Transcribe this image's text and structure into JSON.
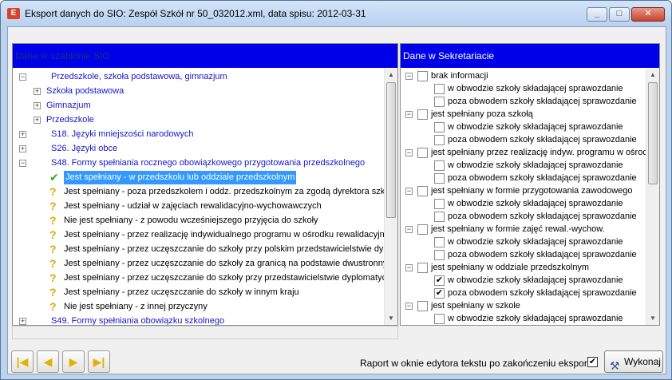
{
  "window": {
    "title": "Eksport danych do SIO: Zespół Szkół nr 50_032012.xml, data spisu: 2012-03-31",
    "app_icon_glyph": "E"
  },
  "left_panel": {
    "header": "Dane w szablonie SIO",
    "rows": [
      {
        "text": "Przedszkole, szkoła podstawowa, gimnazjum",
        "type": "link",
        "expander": "−",
        "level": 0
      },
      {
        "text": "Szkoła podstawowa",
        "type": "link",
        "expander": "+",
        "level": 1
      },
      {
        "text": "Gimnazjum",
        "type": "link",
        "expander": "+",
        "level": 1
      },
      {
        "text": "Przedszkole",
        "type": "link",
        "expander": "+",
        "level": 1
      },
      {
        "text": "S18. Języki mniejszości narodowych",
        "type": "link",
        "expander": "+",
        "level": 0
      },
      {
        "text": "S26. Języki obce",
        "type": "link",
        "expander": "+",
        "level": 0
      },
      {
        "text": "S48. Formy spełniania rocznego obowiązkowego przygotowania przedszkolnego",
        "type": "link",
        "expander": "−",
        "level": 0
      },
      {
        "text": "Jest spełniany - w przedszkolu lub oddziale przedszkolnym",
        "type": "selected",
        "icon": "check",
        "level": 2
      },
      {
        "text": "Jest spełniany - poza przedszkolem i oddz. przedszkolnym za zgodą dyrektora szkoły lub prz",
        "type": "plain",
        "icon": "question",
        "level": 2
      },
      {
        "text": "Jest spełniany - udział w zajęciach rewalidacyjno-wychowawczych",
        "type": "plain",
        "icon": "question",
        "level": 2
      },
      {
        "text": "Nie jest spełniany - z powodu wcześniejszego przyjęcia do szkoły",
        "type": "plain",
        "icon": "question",
        "level": 2
      },
      {
        "text": "Jest spełniany - przez realizację indywidualnego programu w ośrodku rewalidacyjno-wychowa",
        "type": "plain",
        "icon": "question",
        "level": 2
      },
      {
        "text": "Jest spełniany - przez uczęszczanie do szkoły przy polskim przedstawicielstwie dyplomatyc",
        "type": "plain",
        "icon": "question",
        "level": 2
      },
      {
        "text": "Jest spełniany - przez uczęszczanie do szkoły za granicą na podstawie dwustronnych umów",
        "type": "plain",
        "icon": "question",
        "level": 2
      },
      {
        "text": "Jest spełniany - przez uczęszczanie do szkoły przy przedstawicielstwie dyplomatycznym inn",
        "type": "plain",
        "icon": "question",
        "level": 2
      },
      {
        "text": "Jest spełniany - przez uczęszczanie do szkoły w innym kraju",
        "type": "plain",
        "icon": "question",
        "level": 2
      },
      {
        "text": "Nie jest spełniany - z innej przyczyny",
        "type": "plain",
        "icon": "question",
        "level": 2
      },
      {
        "text": "S49. Formy spełniania obowiązku szkolnego",
        "type": "link",
        "expander": "+",
        "level": 0
      }
    ]
  },
  "right_panel": {
    "header": "Dane w Sekretariacie",
    "groups": [
      {
        "label": "brak informacji",
        "checked": false,
        "children": [
          {
            "label": "w obwodzie szkoły składającej sprawozdanie",
            "checked": false
          },
          {
            "label": "poza obwodem szkoły składającej sprawozdanie",
            "checked": false
          }
        ]
      },
      {
        "label": "jest spełniany poza szkołą",
        "checked": false,
        "children": [
          {
            "label": "w obwodzie szkoły składającej sprawozdanie",
            "checked": false
          },
          {
            "label": "poza obwodem szkoły składającej sprawozdanie",
            "checked": false
          }
        ]
      },
      {
        "label": "jest spełniany przez realizację indyw. programu w ośrodku",
        "checked": false,
        "children": [
          {
            "label": "w obwodzie szkoły składającej sprawozdanie",
            "checked": false
          },
          {
            "label": "poza obwodem szkoły składającej sprawozdanie",
            "checked": false
          }
        ]
      },
      {
        "label": "jest spełniany w formie przygotowania zawodowego",
        "checked": false,
        "children": [
          {
            "label": "w obwodzie szkoły składającej sprawozdanie",
            "checked": false
          },
          {
            "label": "poza obwodem szkoły składającej sprawozdanie",
            "checked": false
          }
        ]
      },
      {
        "label": "jest spełniany w formie zajęć rewal.-wychow.",
        "checked": false,
        "children": [
          {
            "label": "w obwodzie szkoły składającej sprawozdanie",
            "checked": false
          },
          {
            "label": "poza obwodem szkoły składającej sprawozdanie",
            "checked": false
          }
        ]
      },
      {
        "label": "jest spełniany w oddziale przedszkolnym",
        "checked": false,
        "children": [
          {
            "label": "w obwodzie szkoły składającej sprawozdanie",
            "checked": true
          },
          {
            "label": "poza obwodem szkoły składającej sprawozdanie",
            "checked": true
          }
        ]
      },
      {
        "label": "jest spełniany w szkole",
        "checked": false,
        "children": [
          {
            "label": "w obwodzie szkoły składającej sprawozdanie",
            "checked": false
          },
          {
            "label": "poza obwodem szkoły składającej sprawozdanie",
            "checked": false
          }
        ]
      }
    ]
  },
  "footer": {
    "report_label": "Raport w oknie edytora tekstu po zakończeniu eksportu",
    "report_checked": true,
    "run_label": "Wykonaj",
    "nav": [
      "first",
      "previous",
      "next",
      "last"
    ]
  },
  "colors": {
    "header_bg": "#0000e8",
    "link_text": "#1515c8",
    "selection": "#3399ff"
  }
}
